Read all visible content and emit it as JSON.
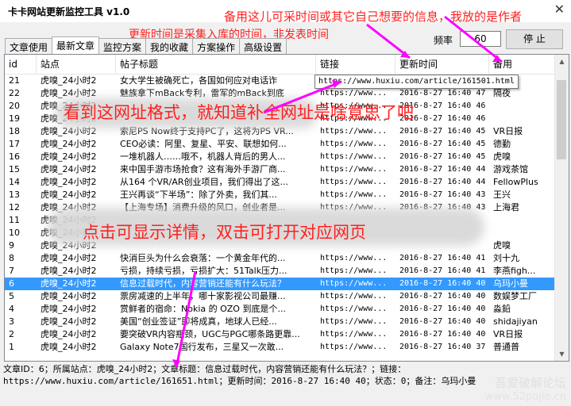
{
  "window": {
    "title": "卡卡网站更新监控工具 v1.0",
    "close": "✕"
  },
  "annotations": {
    "note_field": "备用这儿可采时间或其它自己想要的信息，我放的是作者",
    "update_time": "更新时间是采集入库的时间，非发表时间",
    "url_format": "看到这网址格式，就知道补全网址是啥意思了吧",
    "click_hint": "点击可显示详情，双击可打开对应网页"
  },
  "tabs": [
    "文章使用",
    "最新文章",
    "监控方案",
    "我的收藏",
    "方案操作",
    "高级设置"
  ],
  "controls": {
    "freq_label": "频率",
    "freq_value": "60",
    "stop_label": "停 止"
  },
  "columns": [
    "id",
    "站点",
    "帖子标题",
    "链接",
    "更新时间",
    "备用"
  ],
  "tooltip": "https://www.huxiu.com/article/161501.html",
  "rows": [
    {
      "id": "21",
      "site": "虎嗅_24小时2",
      "title": "女大学生被确死亡，各国如何应对电话诈",
      "link": "",
      "time": "",
      "note": ""
    },
    {
      "id": "22",
      "site": "虎嗅_24小时2",
      "title": "魅族拿下mBack专利，雷军的mBack到底",
      "link": "https://www...",
      "time": "2016-8-27 16:40 47",
      "note": "隔夜"
    },
    {
      "id": "20",
      "site": "虎嗅_24小时2",
      "title": "",
      "link": "https://www...",
      "time": "2016-8-27 16:40 46",
      "note": ""
    },
    {
      "id": "19",
      "site": "虎嗅_24小时2",
      "title": "",
      "link": "https://www...",
      "time": "2016-8-27 16:40 46",
      "note": ""
    },
    {
      "id": "18",
      "site": "虎嗅_24小时2",
      "title": "索尼PS Now终于支持PC了，这将为PS VR...",
      "link": "https://www...",
      "time": "2016-8-27 16:40 45",
      "note": "VR日报"
    },
    {
      "id": "17",
      "site": "虎嗅_24小时2",
      "title": "CEO必读：阿里、复星、平安、联想如何...",
      "link": "https://www...",
      "time": "2016-8-27 16:40 45",
      "note": "德勤"
    },
    {
      "id": "16",
      "site": "虎嗅_24小时2",
      "title": "一堆机器人……哦不，机器人背后的男人...",
      "link": "https://www...",
      "time": "2016-8-27 16:40 45",
      "note": "虎嗅"
    },
    {
      "id": "15",
      "site": "虎嗅_24小时2",
      "title": "来中国手游市场抢食？这有海外手游厂商...",
      "link": "https://www...",
      "time": "2016-8-27 16:40 44",
      "note": "游戏茶馆"
    },
    {
      "id": "14",
      "site": "虎嗅_24小时2",
      "title": "从164 个VR/AR创业项目，我们得出了这...",
      "link": "https://www...",
      "time": "2016-8-27 16:40 44",
      "note": "FellowPlus"
    },
    {
      "id": "13",
      "site": "虎嗅_24小时2",
      "title": "王兴再谈“下半场”：除了外卖，我们其...",
      "link": "https://www...",
      "time": "2016-8-27 16:40 43",
      "note": "王兴"
    },
    {
      "id": "12",
      "site": "虎嗅_24小时2",
      "title": "【上海专场】消费升级的风口，创业者是...",
      "link": "https://www...",
      "time": "2016-8-27 16:40 43",
      "note": "上海君"
    },
    {
      "id": "11",
      "site": "虎嗅_24小时2",
      "title": "",
      "link": "",
      "time": "",
      "note": ""
    },
    {
      "id": "10",
      "site": "虎嗅_24小时2",
      "title": "",
      "link": "",
      "time": "",
      "note": ""
    },
    {
      "id": "9",
      "site": "虎嗅_24小时2",
      "title": "",
      "link": "",
      "time": "",
      "note": "虎嗅"
    },
    {
      "id": "8",
      "site": "虎嗅_24小时2",
      "title": "快消巨头为什么会衰落：一个黄金年代的...",
      "link": "https://www...",
      "time": "2016-8-27 16:40 41",
      "note": "刘十九"
    },
    {
      "id": "7",
      "site": "虎嗅_24小时2",
      "title": "亏损，持续亏损，亏损扩大：51Talk压力...",
      "link": "https://www...",
      "time": "2016-8-27 16:40 41",
      "note": "李燕figh..."
    },
    {
      "id": "6",
      "site": "虎嗅_24小时2",
      "title": "信息过载时代，内容营销还能有什么玩法？",
      "link": "https://www...",
      "time": "2016-8-27 16:40 40",
      "note": "乌玛小曼",
      "selected": true
    },
    {
      "id": "5",
      "site": "虎嗅_24小时2",
      "title": "票房减速的上半年，哪十家影视公司最赚...",
      "link": "https://www...",
      "time": "2016-8-27 16:40 40",
      "note": "数娱梦工厂"
    },
    {
      "id": "4",
      "site": "虎嗅_24小时2",
      "title": "赏鲜者的宿命：Nokia 的 OZO 到底是个...",
      "link": "https://www...",
      "time": "2016-8-27 16:40 40",
      "note": "淼鉛"
    },
    {
      "id": "3",
      "site": "虎嗅_24小时2",
      "title": "美国“创业签证”即将成真，地球人已经...",
      "link": "https://www...",
      "time": "2016-8-27 16:40 40",
      "note": "shidajiyan"
    },
    {
      "id": "2",
      "site": "虎嗅_24小时2",
      "title": "要突破VR内容瓶颈，UGC与PGC哪条路更靠...",
      "link": "https://www...",
      "time": "2016-8-27 16:40 40",
      "note": "VR日报"
    },
    {
      "id": "1",
      "site": "虎嗅_24小时2",
      "title": "Galaxy Note7国行发布，三星又一次敢...",
      "link": "https://www...",
      "time": "2016-8-27 16:40 37",
      "note": "普通普"
    }
  ],
  "detail": {
    "line1": "文章ID：6；所属站点：虎嗅_24小时2；文章标题：信息过载时代，内容营销还能有什么玩法？；链接：",
    "line2": "https://www.huxiu.com/article/161651.html；更新时间：2016-8-27 16:40 40；状态：0；备注：乌玛小曼"
  },
  "watermark": {
    "cn": "吾爱破解论坛",
    "url": "www.52pojie.cn"
  },
  "colors": {
    "annotation": "#ff2020",
    "arrow": "#ff00ff",
    "selection": "#3399ff"
  }
}
